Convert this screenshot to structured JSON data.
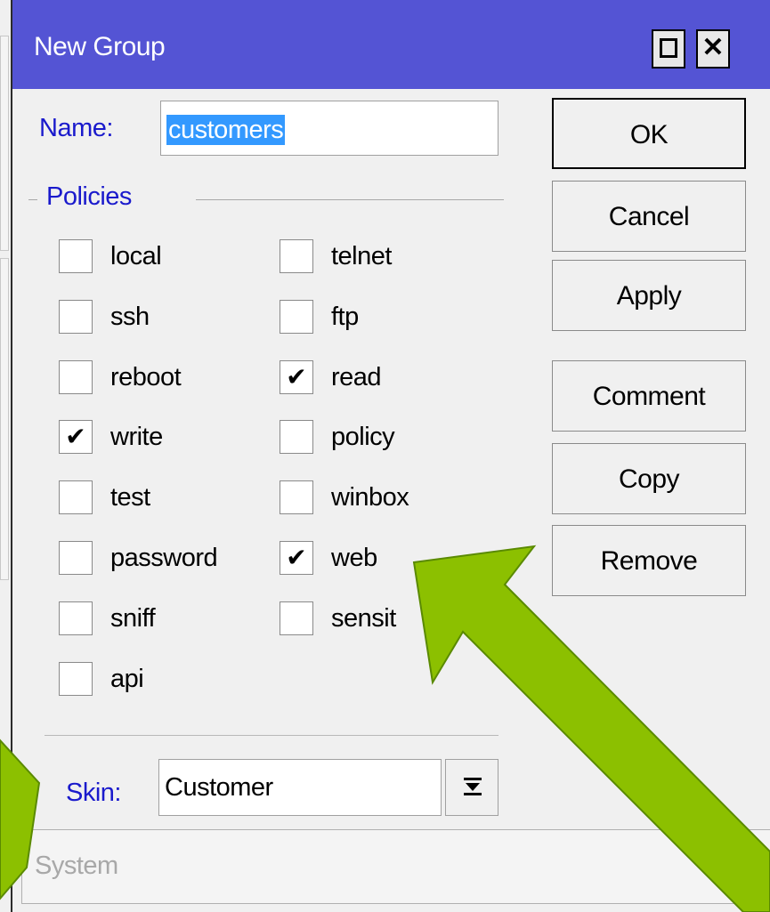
{
  "window": {
    "title": "New Group",
    "maximize_icon": "maximize-icon",
    "close_icon": "close-icon",
    "close_glyph": "✕"
  },
  "form": {
    "name_label": "Name:",
    "name_value": "customers",
    "policies_label": "Policies",
    "policies_left": [
      {
        "label": "local",
        "checked": false
      },
      {
        "label": "ssh",
        "checked": false
      },
      {
        "label": "reboot",
        "checked": false
      },
      {
        "label": "write",
        "checked": true
      },
      {
        "label": "test",
        "checked": false
      },
      {
        "label": "password",
        "checked": false
      },
      {
        "label": "sniff",
        "checked": false
      },
      {
        "label": "api",
        "checked": false
      }
    ],
    "policies_right": [
      {
        "label": "telnet",
        "checked": false
      },
      {
        "label": "ftp",
        "checked": false
      },
      {
        "label": "read",
        "checked": true
      },
      {
        "label": "policy",
        "checked": false
      },
      {
        "label": "winbox",
        "checked": false
      },
      {
        "label": "web",
        "checked": true
      },
      {
        "label": "sensit",
        "checked": false
      }
    ],
    "skin_label": "Skin:",
    "skin_value": "Customer"
  },
  "buttons": {
    "ok": "OK",
    "cancel": "Cancel",
    "apply": "Apply",
    "comment": "Comment",
    "copy": "Copy",
    "remove": "Remove"
  },
  "status": {
    "text": "System"
  },
  "colors": {
    "titlebar": "#5454d4",
    "label_blue": "#1a1acc",
    "selection": "#3399ff",
    "annotation_arrow": "#8cc000"
  },
  "check_glyph": "✔"
}
